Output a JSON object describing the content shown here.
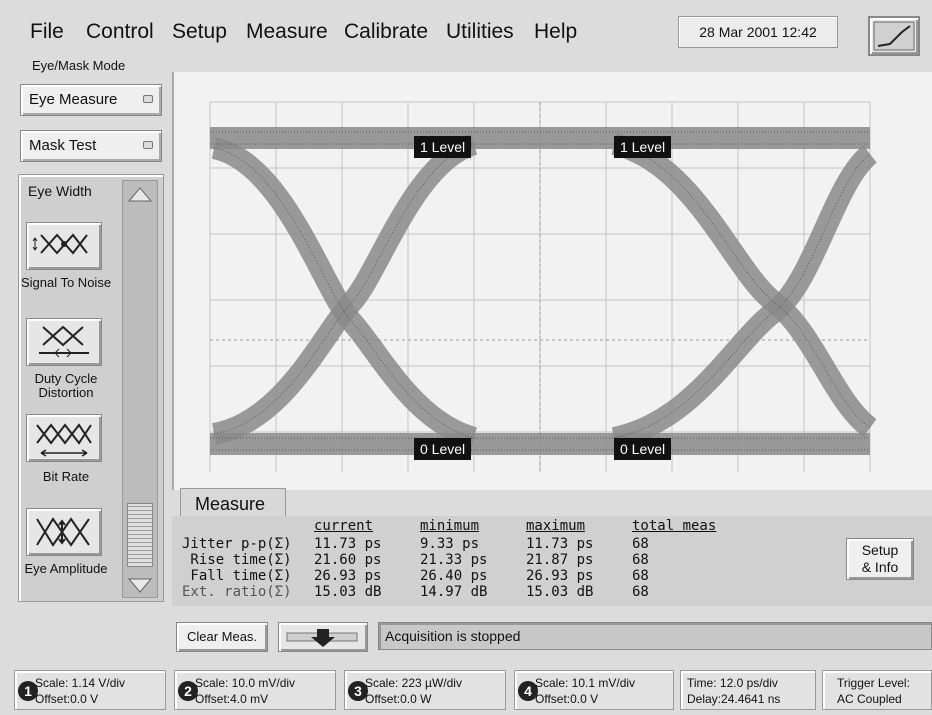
{
  "menu": {
    "items": [
      {
        "label": "File"
      },
      {
        "label": "Control"
      },
      {
        "label": "Setup"
      },
      {
        "label": "Measure"
      },
      {
        "label": "Calibrate"
      },
      {
        "label": "Utilities"
      },
      {
        "label": "Help"
      }
    ],
    "datetime": "28 Mar 2001   12:42"
  },
  "left_panel": {
    "mode_group_label": "Eye/Mask Mode",
    "eye_measure_label": "Eye Measure",
    "mask_test_label": "Mask Test",
    "toolbox_title": "Eye Width",
    "tools": [
      {
        "label": "Signal To Noise",
        "icon": "signal-to-noise-icon"
      },
      {
        "label": "Duty Cycle Distortion",
        "icon": "duty-cycle-icon"
      },
      {
        "label": "Bit Rate",
        "icon": "bit-rate-icon"
      },
      {
        "label": "Eye Amplitude",
        "icon": "eye-amplitude-icon"
      }
    ]
  },
  "graticule": {
    "level_tags": [
      "1 Level",
      "1 Level",
      "0 Level",
      "0 Level"
    ]
  },
  "measure": {
    "tab_label": "Measure",
    "headers": [
      "current",
      "minimum",
      "maximum",
      "total meas"
    ],
    "rows": [
      {
        "name": "Jitter p-p(Σ)",
        "current": "11.73 ps",
        "minimum": "9.33 ps",
        "maximum": "11.73 ps",
        "total": "68"
      },
      {
        "name": " Rise time(Σ)",
        "current": "21.60 ps",
        "minimum": "21.33 ps",
        "maximum": "21.87 ps",
        "total": "68"
      },
      {
        "name": " Fall time(Σ)",
        "current": "26.93 ps",
        "minimum": "26.40 ps",
        "maximum": "26.93 ps",
        "total": "68"
      },
      {
        "name": "Ext. ratio(Σ)",
        "current": "15.03 dB",
        "minimum": "14.97 dB",
        "maximum": "15.03 dB",
        "total": "68"
      }
    ],
    "setup_info_label_1": "Setup",
    "setup_info_label_2": "& Info"
  },
  "controls": {
    "clear_label": "Clear Meas.",
    "status": "Acquisition is stopped"
  },
  "channels": [
    {
      "num": "1",
      "scale": "Scale: 1.14 V/div",
      "offset": "Offset:0.0 V"
    },
    {
      "num": "2",
      "scale": "Scale: 10.0 mV/div",
      "offset": "Offset:4.0 mV"
    },
    {
      "num": "3",
      "scale": "Scale: 223 µW/div",
      "offset": "Offset:0.0 W"
    },
    {
      "num": "4",
      "scale": "Scale: 10.1 mV/div",
      "offset": "Offset:0.0 V"
    }
  ],
  "timebase": {
    "time": "Time: 12.0 ps/div",
    "delay": "Delay:24.4641 ns"
  },
  "trigger": {
    "level": "Trigger Level:",
    "coupling": "AC Coupled"
  },
  "colors": {
    "trace": "#8a8a8a",
    "graticule_bg": "#f2f2f2",
    "tag_bg": "#111111"
  }
}
